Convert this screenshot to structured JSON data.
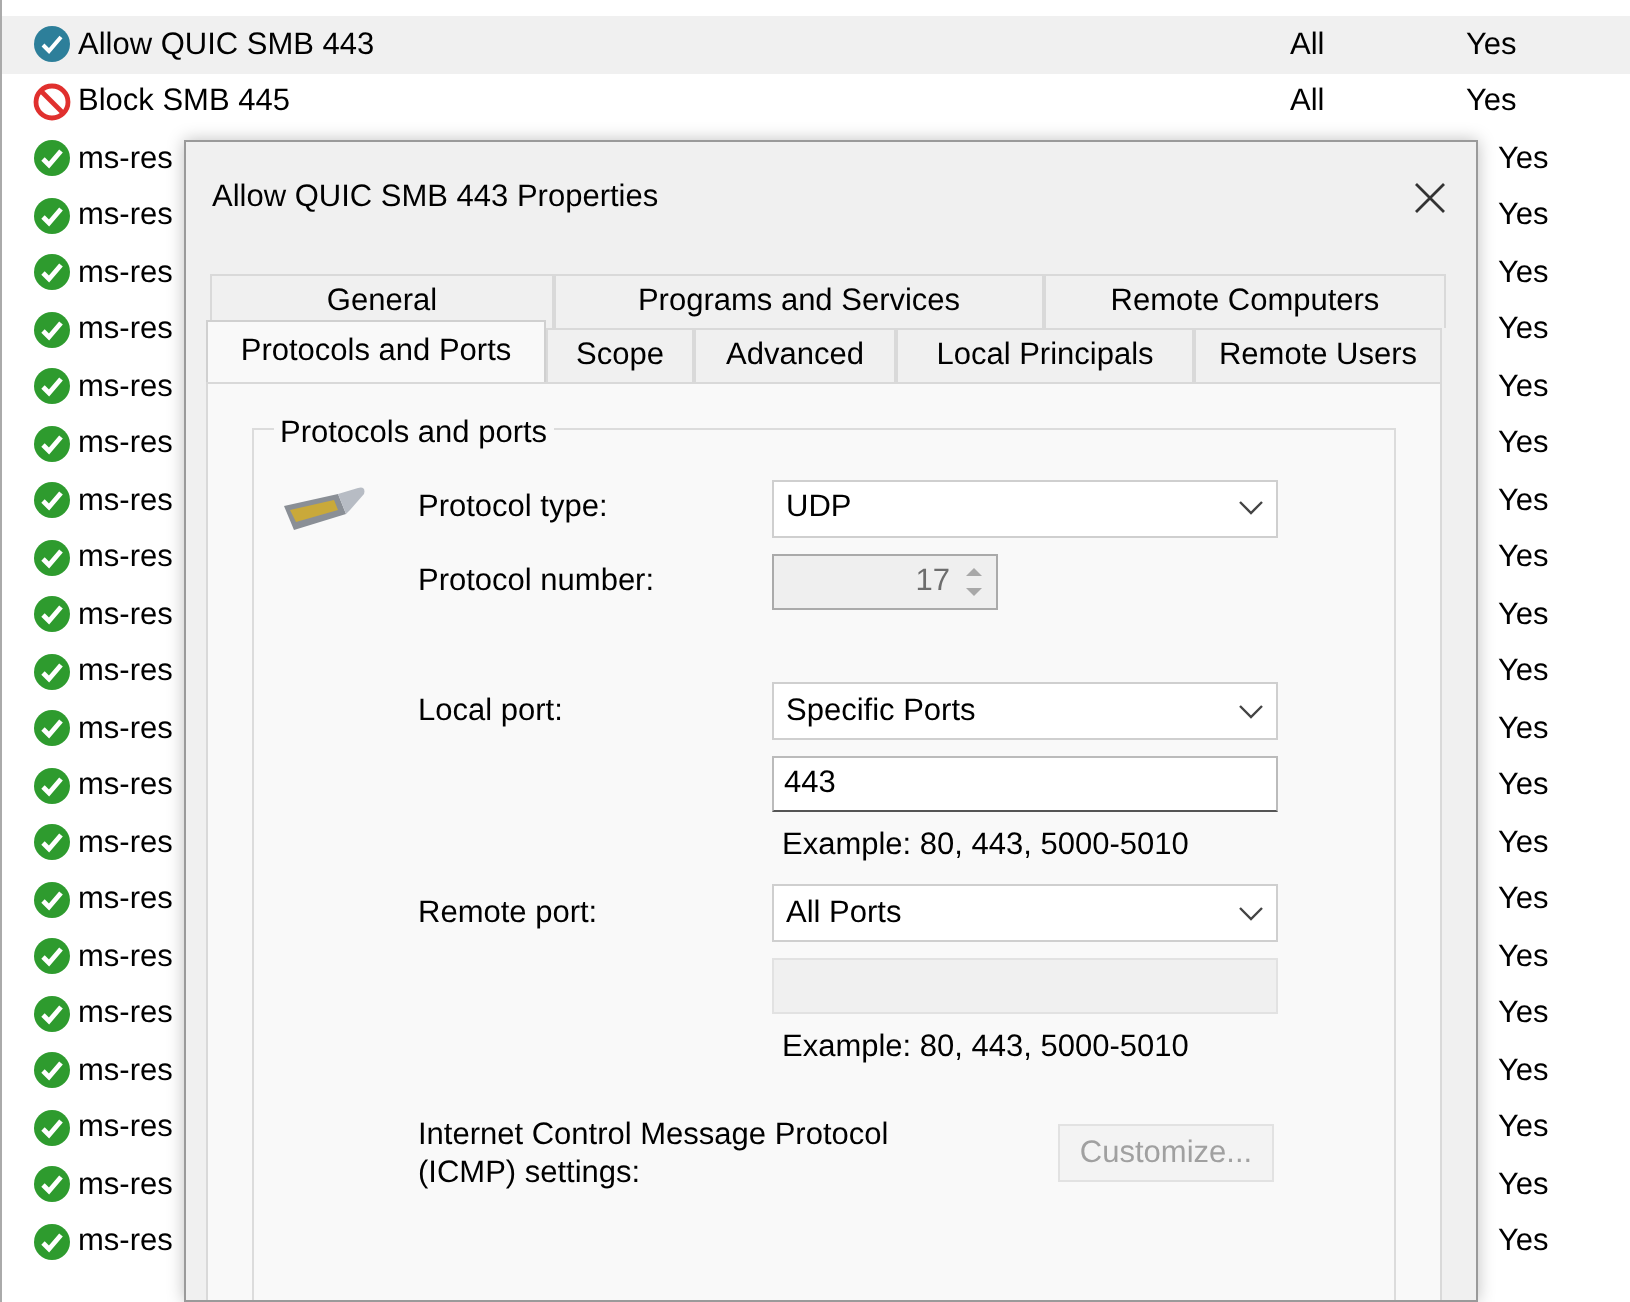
{
  "rules": [
    {
      "kind": "allow_shield",
      "name": "Allow QUIC SMB 443",
      "profile": "All",
      "enabled": "Yes",
      "selected": true
    },
    {
      "kind": "block",
      "name": "Block SMB 445",
      "profile": "All",
      "enabled": "Yes",
      "selected": false
    },
    {
      "kind": "allow",
      "name": "ms-res",
      "enabled": "Yes",
      "selected": false
    },
    {
      "kind": "allow",
      "name": "ms-res",
      "enabled": "Yes",
      "selected": false
    },
    {
      "kind": "allow",
      "name": "ms-res",
      "enabled": "Yes",
      "selected": false
    },
    {
      "kind": "allow",
      "name": "ms-res",
      "enabled": "Yes",
      "selected": false
    },
    {
      "kind": "allow",
      "name": "ms-res",
      "enabled": "Yes",
      "selected": false
    },
    {
      "kind": "allow",
      "name": "ms-res",
      "enabled": "Yes",
      "selected": false
    },
    {
      "kind": "allow",
      "name": "ms-res",
      "enabled": "Yes",
      "selected": false
    },
    {
      "kind": "allow",
      "name": "ms-res",
      "enabled": "Yes",
      "selected": false
    },
    {
      "kind": "allow",
      "name": "ms-res",
      "enabled": "Yes",
      "selected": false
    },
    {
      "kind": "allow",
      "name": "ms-res",
      "enabled": "Yes",
      "selected": false
    },
    {
      "kind": "allow",
      "name": "ms-res",
      "enabled": "Yes",
      "selected": false
    },
    {
      "kind": "allow",
      "name": "ms-res",
      "enabled": "Yes",
      "selected": false
    },
    {
      "kind": "allow",
      "name": "ms-res",
      "enabled": "Yes",
      "selected": false
    },
    {
      "kind": "allow",
      "name": "ms-res",
      "enabled": "Yes",
      "selected": false
    },
    {
      "kind": "allow",
      "name": "ms-res",
      "enabled": "Yes",
      "selected": false
    },
    {
      "kind": "allow",
      "name": "ms-res",
      "enabled": "Yes",
      "selected": false
    },
    {
      "kind": "allow",
      "name": "ms-res",
      "enabled": "Yes",
      "selected": false
    },
    {
      "kind": "allow",
      "name": "ms-res",
      "enabled": "Yes",
      "selected": false
    },
    {
      "kind": "allow",
      "name": "ms-res",
      "enabled": "Yes",
      "selected": false
    },
    {
      "kind": "allow",
      "name": "ms-res",
      "enabled": "Yes",
      "selected": false
    }
  ],
  "dialog": {
    "title": "Allow QUIC SMB 443 Properties",
    "tab_rows": [
      [
        {
          "label": "General",
          "selected": false
        },
        {
          "label": "Programs and Services",
          "selected": false
        },
        {
          "label": "Remote Computers",
          "selected": false
        }
      ],
      [
        {
          "label": "Protocols and Ports",
          "selected": true
        },
        {
          "label": "Scope",
          "selected": false
        },
        {
          "label": "Advanced",
          "selected": false
        },
        {
          "label": "Local Principals",
          "selected": false
        },
        {
          "label": "Remote Users",
          "selected": false
        }
      ]
    ],
    "group_title": "Protocols and ports",
    "protocol_type": {
      "label": "Protocol type:",
      "value": "UDP"
    },
    "protocol_number": {
      "label": "Protocol number:",
      "value": "17",
      "disabled": true
    },
    "local_port": {
      "label": "Local port:",
      "value": "Specific Ports",
      "ports": "443",
      "example": "Example: 80, 443, 5000-5010",
      "ports_disabled": false
    },
    "remote_port": {
      "label": "Remote port:",
      "value": "All Ports",
      "example": "Example: 80, 443, 5000-5010",
      "ports_disabled": true
    },
    "icmp": {
      "label": "Internet Control Message Protocol (ICMP) settings:",
      "button": "Customize...",
      "disabled": true
    }
  }
}
